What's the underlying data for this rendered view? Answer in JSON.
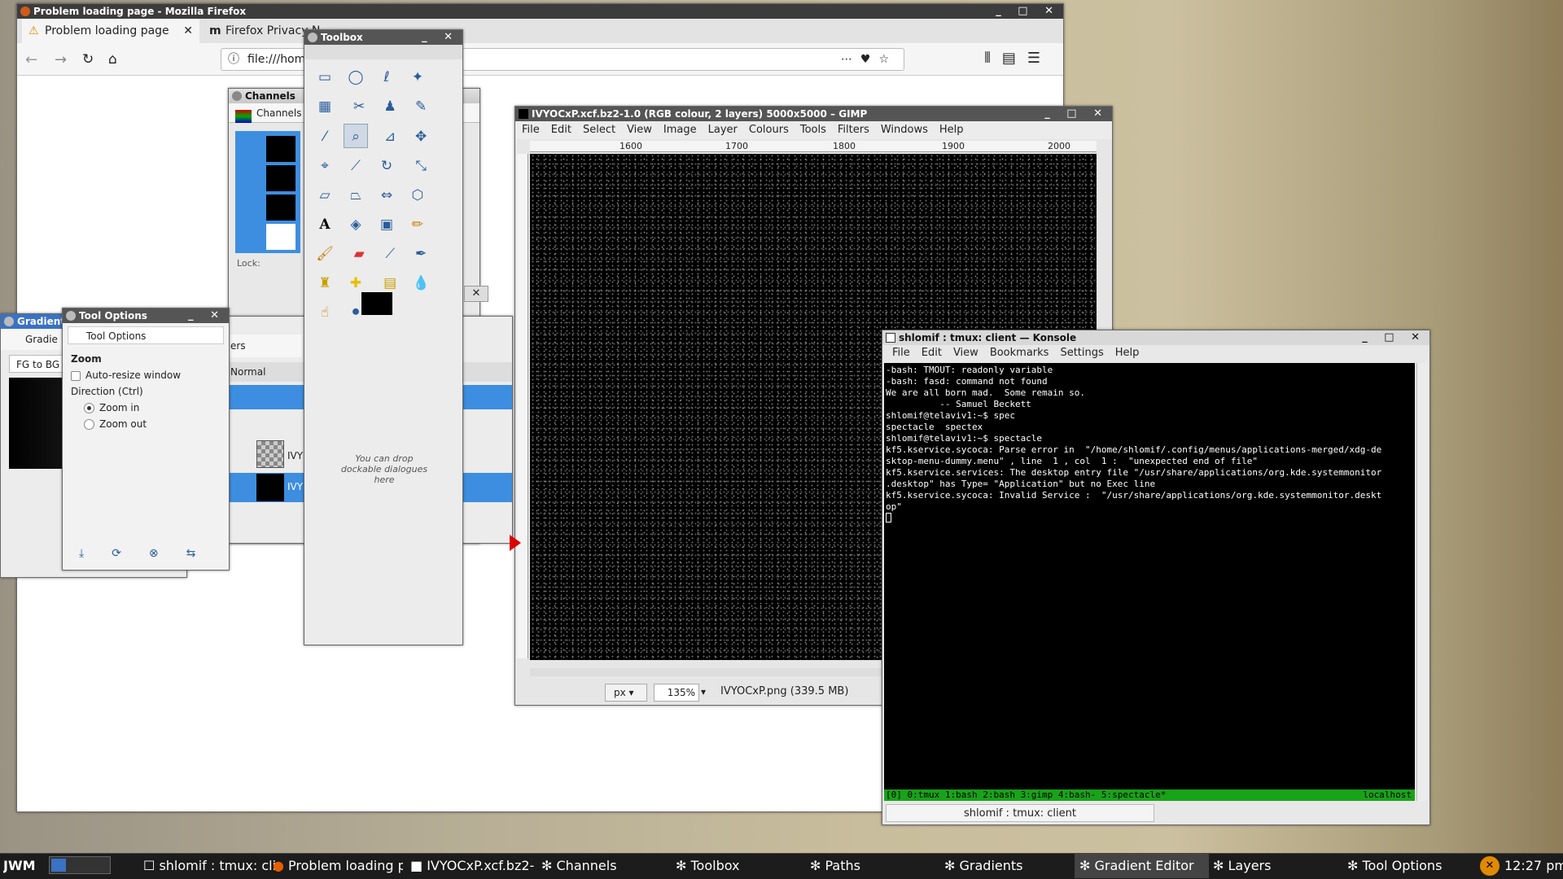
{
  "firefox": {
    "title": "Problem loading page - Mozilla Firefox",
    "tab1": "Problem loading page",
    "tab2": "Firefox Privacy N",
    "url": "file:///home"
  },
  "channels": {
    "title": "Channels",
    "tab": "Channels",
    "lock": "Lock:"
  },
  "toolbox": {
    "title": "Toolbox",
    "drop_hint": "You can drop dockable dialogues here"
  },
  "tool_options": {
    "title": "Tool Options",
    "tab": "Tool Options",
    "section": "Zoom",
    "auto_resize": "Auto-resize window",
    "direction": "Direction  (Ctrl)",
    "zoom_in": "Zoom in",
    "zoom_out": "Zoom out"
  },
  "gradient": {
    "title": "Gradient",
    "tab": "Gradie",
    "preset": "FG to BG"
  },
  "layers": {
    "tab_partial": "ers",
    "mode": "Normal",
    "layer1": "IVY",
    "layer2": "IVY"
  },
  "gimp": {
    "title": "IVYOCxP.xcf.bz2-1.0 (RGB colour, 2 layers) 5000x5000 – GIMP",
    "menu": [
      "File",
      "Edit",
      "Select",
      "View",
      "Image",
      "Layer",
      "Colours",
      "Tools",
      "Filters",
      "Windows",
      "Help"
    ],
    "ruler": [
      "1600",
      "1700",
      "1800",
      "1900",
      "2000"
    ],
    "unit": "px",
    "zoom": "135%",
    "status": "IVYOCxP.png (339.5 MB)"
  },
  "konsole": {
    "title": "shlomif : tmux: client — Konsole",
    "menu": [
      "File",
      "Edit",
      "View",
      "Bookmarks",
      "Settings",
      "Help"
    ],
    "lines": [
      "-bash: TMOUT: readonly variable",
      "-bash: fasd: command not found",
      "We are all born mad.  Some remain so.",
      "          -- Samuel Beckett",
      "shlomif@telaviv1:~$ spec",
      "spectacle  spectex",
      "shlomif@telaviv1:~$ spectacle",
      "kf5.kservice.sycoca: Parse error in  \"/home/shlomif/.config/menus/applications-merged/xdg-de",
      "sktop-menu-dummy.menu\" , line  1 , col  1 :  \"unexpected end of file\"",
      "kf5.kservice.services: The desktop entry file \"/usr/share/applications/org.kde.systemmonitor",
      ".desktop\" has Type= \"Application\" but no Exec line",
      "kf5.kservice.sycoca: Invalid Service :  \"/usr/share/applications/org.kde.systemmonitor.deskt",
      "op\""
    ],
    "tmux_left": "[0] 0:tmux  1:bash  2:bash  3:gimp  4:bash- 5:spectacle*",
    "tmux_right": "localhost",
    "tab": "shlomif : tmux: client"
  },
  "taskbar": {
    "jwm": "JWM",
    "items": [
      "shlomif : tmux: cli",
      "Problem loading p",
      "IVYOCxP.xcf.bz2-",
      "Channels",
      "Toolbox",
      "Paths",
      "Gradients",
      "Gradient Editor",
      "Layers",
      "Tool Options"
    ],
    "clock": "12:27 pm"
  }
}
